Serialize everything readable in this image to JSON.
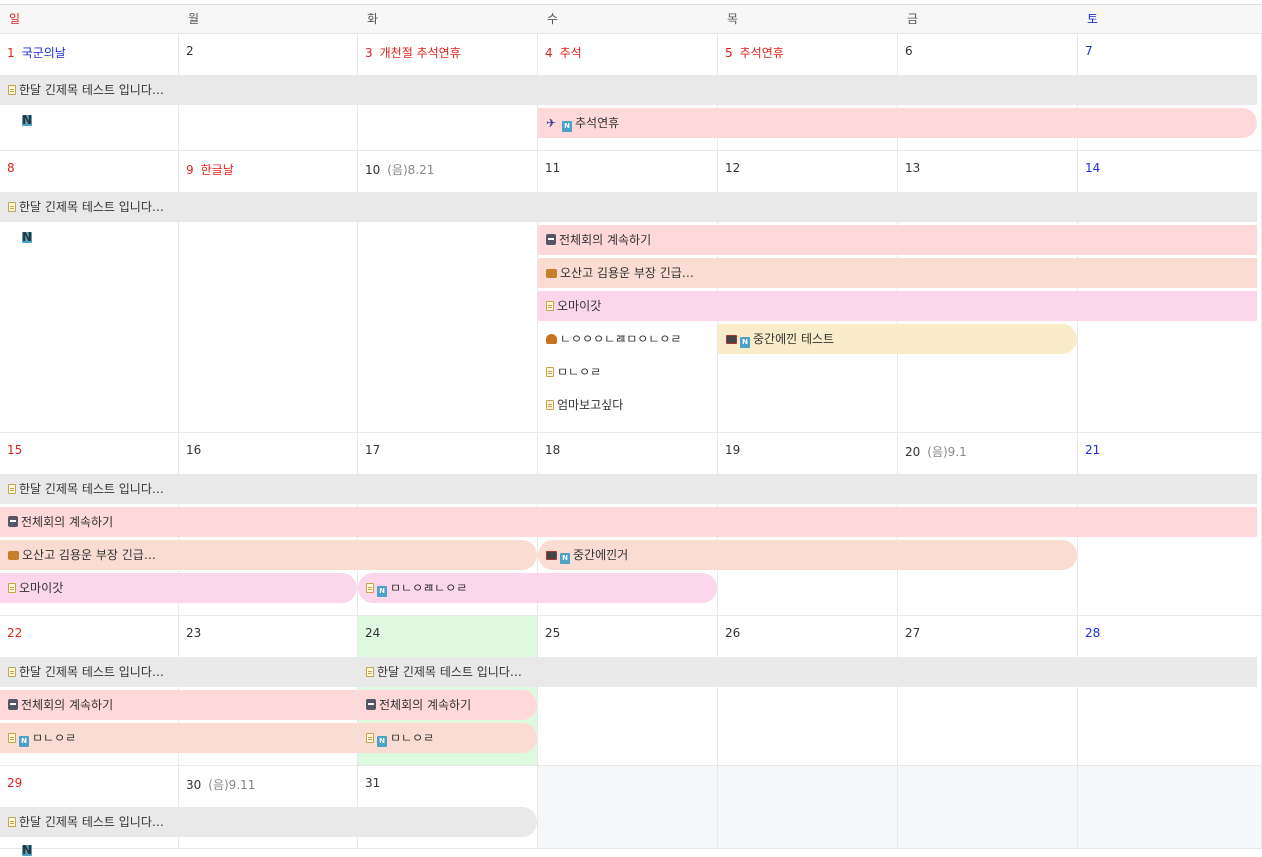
{
  "weekdays": [
    "일",
    "월",
    "화",
    "수",
    "목",
    "금",
    "토"
  ],
  "weeks": [
    {
      "days": [
        {
          "num": "1",
          "holiday": "국군의날",
          "holiday_color": "#1b2fd6"
        },
        {
          "num": "2"
        },
        {
          "num": "3",
          "holiday": "개천절  추석연휴"
        },
        {
          "num": "4",
          "holiday": "추석"
        },
        {
          "num": "5",
          "holiday": "추석연휴"
        },
        {
          "num": "6"
        },
        {
          "num": "7"
        }
      ]
    },
    {
      "days": [
        {
          "num": "8"
        },
        {
          "num": "9",
          "holiday": "한글날"
        },
        {
          "num": "10",
          "lunar": "(음)8.21"
        },
        {
          "num": "11"
        },
        {
          "num": "12"
        },
        {
          "num": "13"
        },
        {
          "num": "14"
        }
      ]
    },
    {
      "days": [
        {
          "num": "15"
        },
        {
          "num": "16"
        },
        {
          "num": "17"
        },
        {
          "num": "18"
        },
        {
          "num": "19"
        },
        {
          "num": "20",
          "lunar": "(음)9.1"
        },
        {
          "num": "21"
        }
      ]
    },
    {
      "days": [
        {
          "num": "22"
        },
        {
          "num": "23"
        },
        {
          "num": "24"
        },
        {
          "num": "25"
        },
        {
          "num": "26"
        },
        {
          "num": "27"
        },
        {
          "num": "28"
        }
      ]
    },
    {
      "days": [
        {
          "num": "29"
        },
        {
          "num": "30",
          "lunar": "(음)9.11"
        },
        {
          "num": "31"
        },
        {
          "num": ""
        },
        {
          "num": ""
        },
        {
          "num": ""
        },
        {
          "num": ""
        }
      ]
    }
  ],
  "events": {
    "long_title": "한달 긴제목 테스트 입니다…",
    "chuseok": "추석연휴",
    "meeting": "전체회의 계속하기",
    "osan": "오산고 김용운 부장 긴급…",
    "omg": "오마이갓",
    "nlooo": "ㄴㅇㅇㅇㄴㄿㅁㅇㄴㅇㄹ",
    "mnor": "ㅁㄴㅇㄹ",
    "mom": "엄마보고싶다",
    "middle1": "중간에낀 테스트",
    "middle2": "중간에낀거",
    "mnolnor": "ㅁㄴㅇㄿㄴㅇㄹ"
  },
  "colors": {
    "gray_bar": "#e9e9e9",
    "red_bar": "#ffd9d9",
    "peach_bar": "#fadcd2",
    "pink_bar": "#fcd6ea",
    "yellow_bar": "#f9ecc8",
    "today": "#dff8e0",
    "sunday": "#e0211b",
    "saturday": "#1b2fd6",
    "holiday": "#e0211b"
  }
}
